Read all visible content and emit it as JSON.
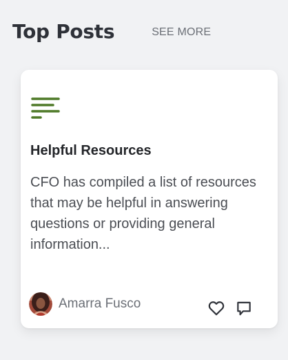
{
  "section": {
    "title": "Top Posts",
    "see_more_label": "SEE MORE"
  },
  "post": {
    "icon": "list-lines-icon",
    "accent_color": "#4f7a28",
    "title": "Helpful Resources",
    "excerpt": " CFO has compiled a list of resources that may be helpful in answering questions or providing general information...",
    "author": {
      "name": "Amarra Fusco",
      "avatar": "avatar-photo"
    },
    "actions": {
      "like_icon": "heart-icon",
      "comment_icon": "comment-icon"
    }
  }
}
